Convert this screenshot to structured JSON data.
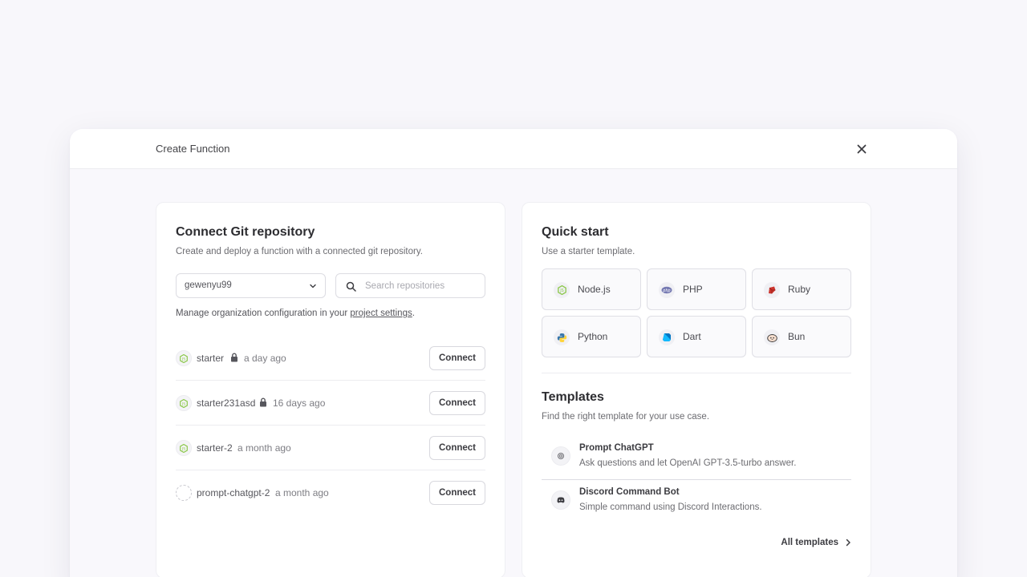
{
  "modal": {
    "title": "Create Function"
  },
  "git": {
    "title": "Connect Git repository",
    "subtitle": "Create and deploy a function with a connected git repository.",
    "org_select": "gewenyu99",
    "search_placeholder": "Search repositories",
    "manage_text": "Manage organization configuration in your ",
    "manage_link": "project settings",
    "manage_suffix": ".",
    "repos": [
      {
        "name": "starter",
        "private": true,
        "time": "a day ago",
        "button": "Connect",
        "icon": "nodejs-icon"
      },
      {
        "name": "starter231asd",
        "private": true,
        "time": "16 days ago",
        "button": "Connect",
        "icon": "nodejs-icon"
      },
      {
        "name": "starter-2",
        "private": false,
        "time": "a month ago",
        "button": "Connect",
        "icon": "nodejs-icon"
      },
      {
        "name": "prompt-chatgpt-2",
        "private": false,
        "time": "a month ago",
        "button": "Connect",
        "icon": "empty-icon"
      }
    ]
  },
  "quickstart": {
    "title": "Quick start",
    "subtitle": "Use a starter template.",
    "runtimes": [
      {
        "label": "Node.js",
        "icon": "nodejs-icon",
        "color": "#8cc84b"
      },
      {
        "label": "PHP",
        "icon": "php-icon",
        "color": "#777bb3"
      },
      {
        "label": "Ruby",
        "icon": "ruby-icon",
        "color": "#cc342d"
      },
      {
        "label": "Python",
        "icon": "python-icon",
        "color": "#3776ab"
      },
      {
        "label": "Dart",
        "icon": "dart-icon",
        "color": "#0175c2"
      },
      {
        "label": "Bun",
        "icon": "bun-icon",
        "color": "#f6dece"
      }
    ]
  },
  "templates": {
    "title": "Templates",
    "subtitle": "Find the right template for your use case.",
    "items": [
      {
        "name": "Prompt ChatGPT",
        "desc": "Ask questions and let OpenAI GPT-3.5-turbo answer.",
        "icon": "openai-icon"
      },
      {
        "name": "Discord Command Bot",
        "desc": "Simple command using Discord Interactions.",
        "icon": "discord-icon"
      }
    ],
    "all_link": "All templates"
  }
}
